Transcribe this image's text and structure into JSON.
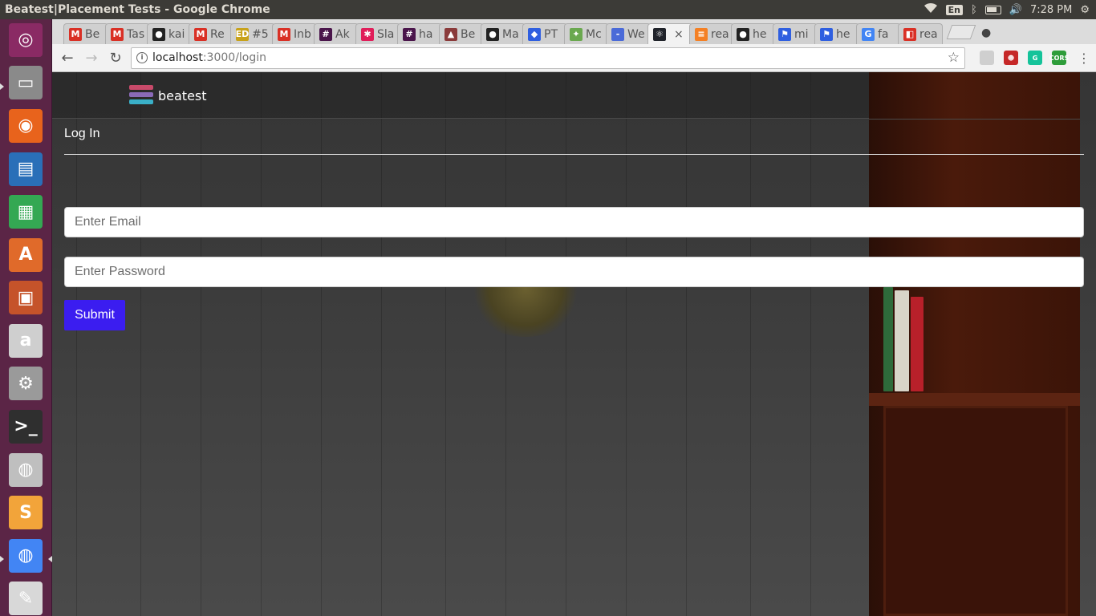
{
  "os_panel": {
    "window_title": "Beatest|Placement Tests - Google Chrome",
    "keyboard_layout": "En",
    "clock": "7:28 PM",
    "icons": [
      "wifi-icon",
      "keyboard-layout-indicator",
      "bluetooth-icon",
      "battery-icon",
      "volume-icon",
      "settings-gear-icon"
    ]
  },
  "launcher": {
    "items": [
      {
        "name": "ubuntu-dash",
        "glyph": "◎",
        "color": "#8a2a64"
      },
      {
        "name": "files",
        "glyph": "▭",
        "color": "#8a8a8a"
      },
      {
        "name": "firefox",
        "glyph": "◉",
        "color": "#e8631c"
      },
      {
        "name": "libreoffice-writer",
        "glyph": "▤",
        "color": "#2a6fb8"
      },
      {
        "name": "libreoffice-calc",
        "glyph": "▦",
        "color": "#34a853"
      },
      {
        "name": "software-center",
        "glyph": "A",
        "color": "#e06a2a"
      },
      {
        "name": "libreoffice-impress",
        "glyph": "▣",
        "color": "#c5532a"
      },
      {
        "name": "amazon",
        "glyph": "a",
        "color": "#cfcfcf"
      },
      {
        "name": "system-settings",
        "glyph": "⚙",
        "color": "#9a9a9a"
      },
      {
        "name": "terminal",
        "glyph": ">_",
        "color": "#2f2f2f"
      },
      {
        "name": "disks",
        "glyph": "◍",
        "color": "#bfbfbf"
      },
      {
        "name": "sublime-text",
        "glyph": "S",
        "color": "#f2a43a"
      },
      {
        "name": "chrome",
        "glyph": "◍",
        "color": "#4285f4"
      },
      {
        "name": "text-editor",
        "glyph": "✎",
        "color": "#d8d8d8"
      }
    ]
  },
  "browser": {
    "tabs": [
      {
        "label": "Be",
        "fav": "M",
        "fav_color": "#d93025"
      },
      {
        "label": "Tas",
        "fav": "M",
        "fav_color": "#d93025"
      },
      {
        "label": "kai",
        "fav": "●",
        "fav_color": "#222222"
      },
      {
        "label": "Re",
        "fav": "M",
        "fav_color": "#d93025"
      },
      {
        "label": "#5",
        "fav": "ED",
        "fav_color": "#c8a21a"
      },
      {
        "label": "Inb",
        "fav": "M",
        "fav_color": "#d93025"
      },
      {
        "label": "Ak",
        "fav": "#",
        "fav_color": "#4a154b"
      },
      {
        "label": "Sla",
        "fav": "✱",
        "fav_color": "#e01e5a"
      },
      {
        "label": "ha",
        "fav": "#",
        "fav_color": "#4a154b"
      },
      {
        "label": "Be",
        "fav": "▲",
        "fav_color": "#8a3a3a"
      },
      {
        "label": "Ma",
        "fav": "●",
        "fav_color": "#222222"
      },
      {
        "label": "PT",
        "fav": "◆",
        "fav_color": "#2f5fe0"
      },
      {
        "label": "Mc",
        "fav": "✦",
        "fav_color": "#6aa84f"
      },
      {
        "label": "We",
        "fav": "-",
        "fav_color": "#4a6ad8"
      },
      {
        "label": "",
        "fav": "⚛",
        "fav_color": "#20232a",
        "active": true
      },
      {
        "label": "rea",
        "fav": "≡",
        "fav_color": "#f48024"
      },
      {
        "label": "he",
        "fav": "●",
        "fav_color": "#222222"
      },
      {
        "label": "mi",
        "fav": "⚑",
        "fav_color": "#2f5fe0"
      },
      {
        "label": "he",
        "fav": "⚑",
        "fav_color": "#2f5fe0"
      },
      {
        "label": "fa",
        "fav": "G",
        "fav_color": "#4285f4"
      },
      {
        "label": "rea",
        "fav": "◧",
        "fav_color": "#d93025"
      }
    ],
    "tab_close_glyph": "×",
    "url_host": "localhost",
    "url_path": ":3000/login",
    "extensions": [
      {
        "name": "extension-refresh-icon",
        "color": "#cfcfcf",
        "glyph": ""
      },
      {
        "name": "extension-red-icon",
        "color": "#c62828",
        "glyph": "☻"
      },
      {
        "name": "grammarly-icon",
        "color": "#15c39a",
        "glyph": "G"
      },
      {
        "name": "cors-extension-icon",
        "color": "#2e9d3a",
        "glyph": "CORS"
      }
    ]
  },
  "app": {
    "brand": "beatest",
    "page_title": "Log In",
    "form": {
      "email_placeholder": "Enter Email",
      "email_value": "",
      "password_placeholder": "Enter Password",
      "password_value": "",
      "submit_label": "Submit"
    },
    "colors": {
      "submit_bg": "#3b1df0",
      "logo_stack": [
        "#c84a6a",
        "#8a6ab8",
        "#3ab0c8"
      ]
    }
  }
}
